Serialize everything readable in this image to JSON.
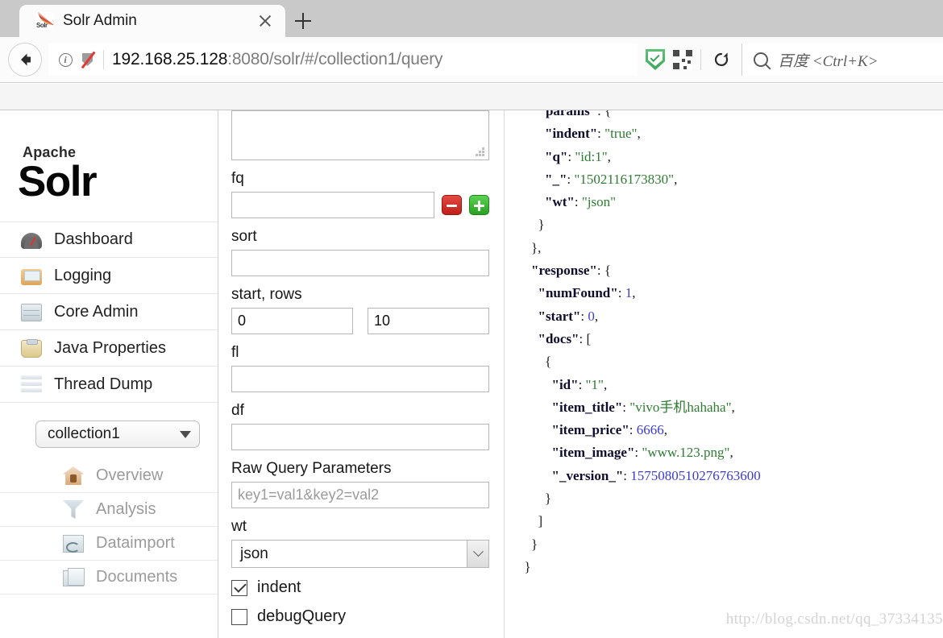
{
  "browser": {
    "tab": {
      "title": "Solr Admin",
      "favicon_icon": "solr-favicon",
      "close_icon": "close-icon"
    },
    "newtab_icon": "plus-icon",
    "back_icon": "back-arrow-icon",
    "identity_icon": "info-circle-icon",
    "insecure_icon": "broken-lock-icon",
    "url": {
      "host": "192.168.25.128",
      "rest": ":8080/solr/#/collection1/query"
    },
    "toolbar_icons": [
      "shield-icon",
      "qr-code-icon",
      "reload-icon"
    ],
    "search": {
      "icon": "search-icon",
      "placeholder": "百度 <Ctrl+K>"
    }
  },
  "sidebar": {
    "logo": {
      "apache": "Apache",
      "solr": "Solr",
      "fan_icon": "solr-sunburst-icon"
    },
    "items": [
      {
        "label": "Dashboard",
        "icon": "dashboard-icon"
      },
      {
        "label": "Logging",
        "icon": "logging-icon"
      },
      {
        "label": "Core Admin",
        "icon": "core-admin-icon"
      },
      {
        "label": "Java Properties",
        "icon": "java-properties-icon"
      },
      {
        "label": "Thread Dump",
        "icon": "thread-dump-icon"
      }
    ],
    "collection_select": {
      "value": "collection1",
      "caret_icon": "chevron-down-icon"
    },
    "subitems": [
      {
        "label": "Overview",
        "icon": "overview-icon"
      },
      {
        "label": "Analysis",
        "icon": "analysis-icon"
      },
      {
        "label": "Dataimport",
        "icon": "dataimport-icon"
      },
      {
        "label": "Documents",
        "icon": "documents-icon"
      }
    ]
  },
  "query_form": {
    "q_value": "",
    "fq": {
      "label": "fq",
      "value": "",
      "remove_icon": "minus-icon",
      "add_icon": "plus-icon"
    },
    "sort": {
      "label": "sort",
      "value": ""
    },
    "start_rows": {
      "label": "start, rows",
      "start": "0",
      "rows": "10"
    },
    "fl": {
      "label": "fl",
      "value": ""
    },
    "df": {
      "label": "df",
      "value": ""
    },
    "raw_query": {
      "label": "Raw Query Parameters",
      "placeholder": "key1=val1&key2=val2",
      "value": ""
    },
    "wt": {
      "label": "wt",
      "value": "json",
      "arrow_icon": "chevron-down-icon"
    },
    "checkboxes": [
      {
        "label": "indent",
        "checked": true
      },
      {
        "label": "debugQuery",
        "checked": false
      }
    ]
  },
  "response": {
    "lines": [
      {
        "indent": 3,
        "parts": [
          {
            "t": "k",
            "v": "\"params\""
          },
          {
            "t": "p",
            "v": ": {"
          }
        ]
      },
      {
        "indent": 4,
        "parts": [
          {
            "t": "k",
            "v": "\"indent\""
          },
          {
            "t": "p",
            "v": ": "
          },
          {
            "t": "s",
            "v": "\"true\""
          },
          {
            "t": "p",
            "v": ","
          }
        ]
      },
      {
        "indent": 4,
        "parts": [
          {
            "t": "k",
            "v": "\"q\""
          },
          {
            "t": "p",
            "v": ": "
          },
          {
            "t": "s",
            "v": "\"id:1\""
          },
          {
            "t": "p",
            "v": ","
          }
        ]
      },
      {
        "indent": 4,
        "parts": [
          {
            "t": "k",
            "v": "\"_\""
          },
          {
            "t": "p",
            "v": ": "
          },
          {
            "t": "s",
            "v": "\"1502116173830\""
          },
          {
            "t": "p",
            "v": ","
          }
        ]
      },
      {
        "indent": 4,
        "parts": [
          {
            "t": "k",
            "v": "\"wt\""
          },
          {
            "t": "p",
            "v": ": "
          },
          {
            "t": "s",
            "v": "\"json\""
          }
        ]
      },
      {
        "indent": 3,
        "parts": [
          {
            "t": "p",
            "v": "}"
          }
        ]
      },
      {
        "indent": 2,
        "parts": [
          {
            "t": "p",
            "v": "},"
          }
        ]
      },
      {
        "indent": 2,
        "parts": [
          {
            "t": "k",
            "v": "\"response\""
          },
          {
            "t": "p",
            "v": ": {"
          }
        ]
      },
      {
        "indent": 3,
        "parts": [
          {
            "t": "k",
            "v": "\"numFound\""
          },
          {
            "t": "p",
            "v": ": "
          },
          {
            "t": "n",
            "v": "1"
          },
          {
            "t": "p",
            "v": ","
          }
        ]
      },
      {
        "indent": 3,
        "parts": [
          {
            "t": "k",
            "v": "\"start\""
          },
          {
            "t": "p",
            "v": ": "
          },
          {
            "t": "n",
            "v": "0"
          },
          {
            "t": "p",
            "v": ","
          }
        ]
      },
      {
        "indent": 3,
        "parts": [
          {
            "t": "k",
            "v": "\"docs\""
          },
          {
            "t": "p",
            "v": ": ["
          }
        ]
      },
      {
        "indent": 4,
        "parts": [
          {
            "t": "p",
            "v": "{"
          }
        ]
      },
      {
        "indent": 5,
        "parts": [
          {
            "t": "k",
            "v": "\"id\""
          },
          {
            "t": "p",
            "v": ": "
          },
          {
            "t": "s",
            "v": "\"1\""
          },
          {
            "t": "p",
            "v": ","
          }
        ]
      },
      {
        "indent": 5,
        "parts": [
          {
            "t": "k",
            "v": "\"item_title\""
          },
          {
            "t": "p",
            "v": ": "
          },
          {
            "t": "s",
            "v": "\"vivo手机hahaha\""
          },
          {
            "t": "p",
            "v": ","
          }
        ]
      },
      {
        "indent": 5,
        "parts": [
          {
            "t": "k",
            "v": "\"item_price\""
          },
          {
            "t": "p",
            "v": ": "
          },
          {
            "t": "n",
            "v": "6666"
          },
          {
            "t": "p",
            "v": ","
          }
        ]
      },
      {
        "indent": 5,
        "parts": [
          {
            "t": "k",
            "v": "\"item_image\""
          },
          {
            "t": "p",
            "v": ": "
          },
          {
            "t": "s",
            "v": "\"www.123.png\""
          },
          {
            "t": "p",
            "v": ","
          }
        ]
      },
      {
        "indent": 5,
        "parts": [
          {
            "t": "k",
            "v": "\"_version_\""
          },
          {
            "t": "p",
            "v": ": "
          },
          {
            "t": "n",
            "v": "1575080510276763600"
          }
        ]
      },
      {
        "indent": 4,
        "parts": [
          {
            "t": "p",
            "v": "}"
          }
        ]
      },
      {
        "indent": 3,
        "parts": [
          {
            "t": "p",
            "v": "]"
          }
        ]
      },
      {
        "indent": 2,
        "parts": [
          {
            "t": "p",
            "v": "}"
          }
        ]
      },
      {
        "indent": 1,
        "parts": [
          {
            "t": "p",
            "v": "}"
          }
        ]
      }
    ]
  },
  "watermark": "http://blog.csdn.net/qq_37334135"
}
